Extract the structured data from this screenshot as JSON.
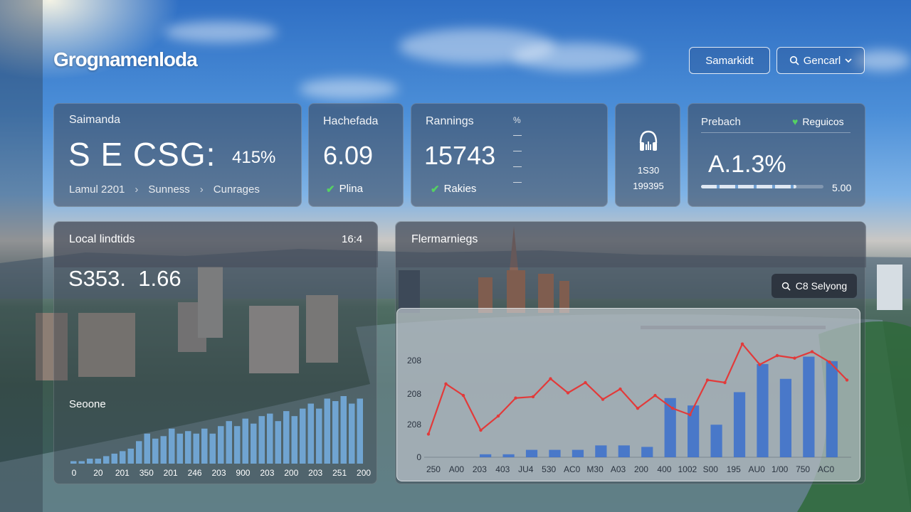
{
  "header": {
    "brand": "Grognamenloda",
    "button_primary": "Samarkidt",
    "search_button": "Gencarl"
  },
  "cards": {
    "summary": {
      "title": "Saimanda",
      "headline": "S E CSG:",
      "percent": "415%",
      "breadcrumb": [
        "Lamul 2201",
        "Sunness",
        "Cunrages"
      ]
    },
    "hachefada": {
      "title": "Hachefada",
      "value": "6.09",
      "status": "Plina"
    },
    "rannings": {
      "title": "Rannings",
      "value": "15743",
      "status": "Rakies",
      "corner_mark": "%"
    },
    "device": {
      "line1": "1S30",
      "line2": "199395"
    },
    "prebach": {
      "title": "Prebach",
      "badge": "Reguicos",
      "value": "A.1.3%",
      "progress_label": "5.00",
      "progress": 0.78
    }
  },
  "left_panel": {
    "title": "Local lindtids",
    "corner": "16:4",
    "values": "S353.  1.66",
    "chart_title": "Seoone",
    "chart_data": {
      "type": "bar",
      "x_tick_labels": [
        "0",
        "20",
        "201",
        "350",
        "201",
        "246",
        "203",
        "900",
        "203",
        "200",
        "203",
        "251",
        "200"
      ],
      "values": [
        1,
        1,
        2,
        2,
        3,
        4,
        5,
        6,
        9,
        12,
        10,
        11,
        14,
        12,
        13,
        12,
        14,
        12,
        15,
        17,
        15,
        18,
        16,
        19,
        20,
        17,
        21,
        19,
        22,
        24,
        22,
        26,
        25,
        27,
        24,
        26
      ]
    }
  },
  "right_panel": {
    "title": "Flermarniegs",
    "search_label": "C8 Selyong",
    "chart_data": {
      "type": "bar+line",
      "y_tick_labels": [
        "0",
        "208",
        "208",
        "208"
      ],
      "categories": [
        "250",
        "A00",
        "203",
        "403",
        "JU4",
        "530",
        "AC0",
        "M30",
        "A03",
        "200",
        "400",
        "1002",
        "S00",
        "195",
        "AU0",
        "1/00",
        "750",
        "AC0"
      ],
      "bar_values": [
        0,
        0,
        2,
        2,
        5,
        5,
        5,
        8,
        8,
        7,
        40,
        35,
        22,
        44,
        63,
        53,
        68,
        65
      ],
      "line_values": [
        18,
        57,
        48,
        21,
        32,
        46,
        47,
        61,
        50,
        58,
        45,
        53,
        38,
        48,
        38,
        33,
        60,
        58,
        88,
        72,
        79,
        77,
        82,
        74,
        60
      ]
    }
  }
}
